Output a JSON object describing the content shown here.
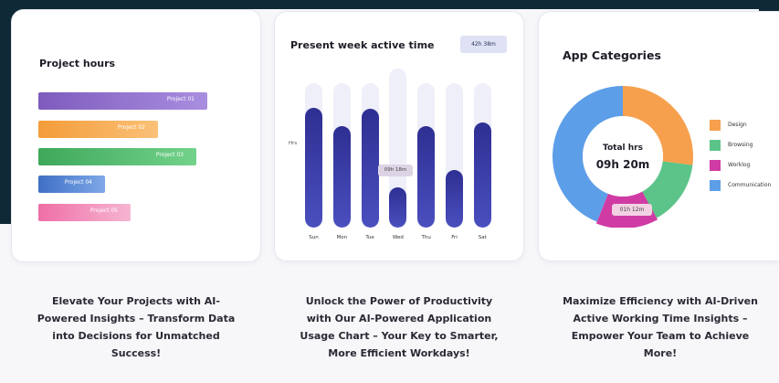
{
  "colors": {
    "accent_dark": "#0f2a36",
    "bar_blue": "#2e2f92",
    "design": "#f6a04d",
    "browsing": "#5cc489",
    "worklog": "#d03ba3",
    "communication": "#5d9ee8"
  },
  "project_hours": {
    "title": "Project hours",
    "chart_data": {
      "type": "bar",
      "orientation": "horizontal",
      "categories": [
        "Project 01",
        "Project 02",
        "Project 03",
        "Project 04",
        "Project 05"
      ],
      "values": [
        185,
        131,
        173,
        73,
        101
      ],
      "colors": [
        [
          "#7e5bbd",
          "#a98ee0"
        ],
        [
          "#f39c3a",
          "#fbc177"
        ],
        [
          "#3ea85a",
          "#73d28b"
        ],
        [
          "#3f6fc4",
          "#7ea8e8"
        ],
        [
          "#ef6fa6",
          "#f6b5d2"
        ]
      ]
    }
  },
  "active_time": {
    "title": "Present week active time",
    "total": "42h 38m",
    "axis_label": "Hrs",
    "hover_value": "09h 18m",
    "chart_data": {
      "type": "bar",
      "categories": [
        "Sun",
        "Mon",
        "Tue",
        "Wed",
        "Thu",
        "Fri",
        "Sat"
      ],
      "values": [
        0.83,
        0.7,
        0.82,
        0.28,
        0.7,
        0.4,
        0.73
      ],
      "track_values": [
        1.0,
        1.0,
        1.0,
        1.1,
        1.0,
        1.0,
        1.0
      ],
      "ylim": [
        0,
        1.1
      ]
    }
  },
  "app_categories": {
    "title": "App Categories",
    "center_label": "Total hrs",
    "center_value": "09h 20m",
    "hover_value": "01h 12m",
    "chart_data": {
      "type": "pie",
      "categories": [
        "Design",
        "Browsing",
        "Worklog",
        "Communication"
      ],
      "values": [
        27,
        15,
        14,
        44
      ]
    }
  },
  "captions": [
    "Elevate Your Projects with AI-Powered Insights – Transform Data into Decisions for Unmatched Success!",
    "Unlock the Power of Productivity with Our AI-Powered Application Usage Chart – Your Key to Smarter, More Efficient Workdays!",
    "Maximize Efficiency with AI-Driven Active Working Time Insights – Empower Your Team to Achieve More!"
  ]
}
